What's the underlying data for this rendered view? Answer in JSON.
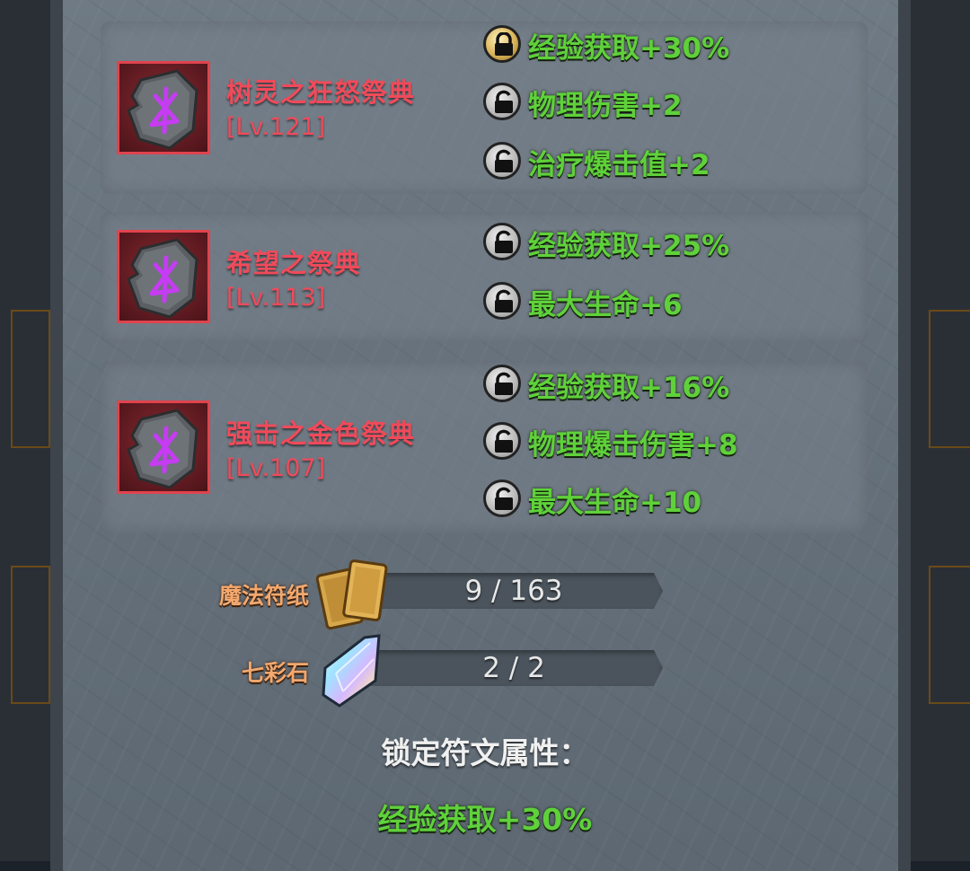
{
  "colors": {
    "rune_name": "#f04a5a",
    "attribute": "#5fd13a",
    "resource_label": "#f2a86e",
    "panel": "#6a757f"
  },
  "runes": [
    {
      "name": "树灵之狂怒祭典",
      "level": "[Lv.121]",
      "icon": "rune-stone-icon",
      "attributes": [
        {
          "text": "经验获取+30%",
          "locked": true
        },
        {
          "text": "物理伤害+2",
          "locked": false
        },
        {
          "text": "治疗爆击值+2",
          "locked": false
        }
      ]
    },
    {
      "name": "希望之祭典",
      "level": "[Lv.113]",
      "icon": "rune-stone-icon",
      "attributes": [
        {
          "text": "经验获取+25%",
          "locked": false
        },
        {
          "text": "最大生命+6",
          "locked": false
        }
      ]
    },
    {
      "name": "强击之金色祭典",
      "level": "[Lv.107]",
      "icon": "rune-stone-icon",
      "attributes": [
        {
          "text": "经验获取+16%",
          "locked": false
        },
        {
          "text": "物理爆击伤害+8",
          "locked": false
        },
        {
          "text": "最大生命+10",
          "locked": false
        }
      ]
    }
  ],
  "resources": [
    {
      "label": "魔法符纸",
      "amount": "9 / 163",
      "icon": "magic-paper-icon"
    },
    {
      "label": "七彩石",
      "amount": "2 / 2",
      "icon": "rainbow-stone-icon"
    }
  ],
  "locked_section": {
    "title": "锁定符文属性：",
    "value": "经验获取+30%"
  }
}
